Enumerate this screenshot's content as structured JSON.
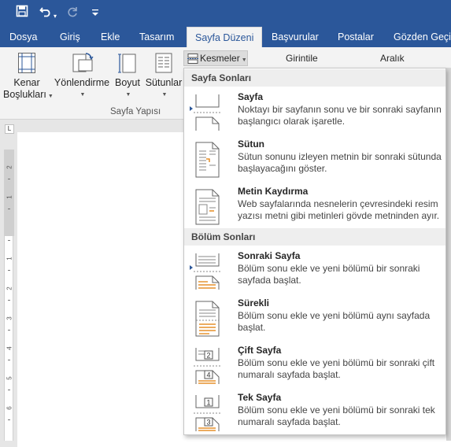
{
  "quick_access": {
    "save_icon": "save-icon",
    "undo_icon": "undo-icon",
    "redo_icon": "redo-icon",
    "customize_icon": "customize-icon"
  },
  "tabs": [
    {
      "label": "Dosya"
    },
    {
      "label": "Giriş"
    },
    {
      "label": "Ekle"
    },
    {
      "label": "Tasarım"
    },
    {
      "label": "Sayfa Düzeni"
    },
    {
      "label": "Başvurular"
    },
    {
      "label": "Postalar"
    },
    {
      "label": "Gözden Geçir"
    }
  ],
  "ribbon": {
    "margins_l1": "Kenar",
    "margins_l2": "Boşlukları",
    "orientation": "Yönlendirme",
    "size": "Boyut",
    "columns": "Sütunlar",
    "group_label": "Sayfa Yapısı",
    "breaks_button": "Kesmeler",
    "indent_label": "Girintile",
    "spacing_label": "Aralık"
  },
  "menu": {
    "section_page": "Sayfa Sonları",
    "section_section": "Bölüm Sonları",
    "items": [
      {
        "title": "Sayfa",
        "desc": "Noktayı bir sayfanın sonu ve bir sonraki sayfanın başlangıcı olarak işaretle."
      },
      {
        "title": "Sütun",
        "desc": "Sütun sonunu izleyen metnin bir sonraki sütunda başlayacağını göster."
      },
      {
        "title": "Metin Kaydırma",
        "desc": "Web sayfalarında nesnelerin çevresindeki resim yazısı metni gibi metinleri gövde metninden ayır."
      },
      {
        "title": "Sonraki Sayfa",
        "desc": "Bölüm sonu ekle ve yeni bölümü bir sonraki sayfada başlat."
      },
      {
        "title": "Sürekli",
        "desc": "Bölüm sonu ekle ve yeni bölümü aynı sayfada başlat."
      },
      {
        "title": "Çift Sayfa",
        "desc": "Bölüm sonu ekle ve yeni bölümü bir sonraki çift numaralı sayfada başlat.",
        "icon_digits": [
          "2",
          "4"
        ]
      },
      {
        "title": "Tek Sayfa",
        "desc": "Bölüm sonu ekle ve yeni bölümü bir sonraki tek numaralı sayfada başlat.",
        "icon_digits": [
          "1",
          "3"
        ]
      }
    ]
  },
  "ruler": {
    "corner_glyph": "L",
    "numbers": [
      "2",
      "1",
      "1",
      "2",
      "3",
      "4",
      "5",
      "6"
    ]
  }
}
